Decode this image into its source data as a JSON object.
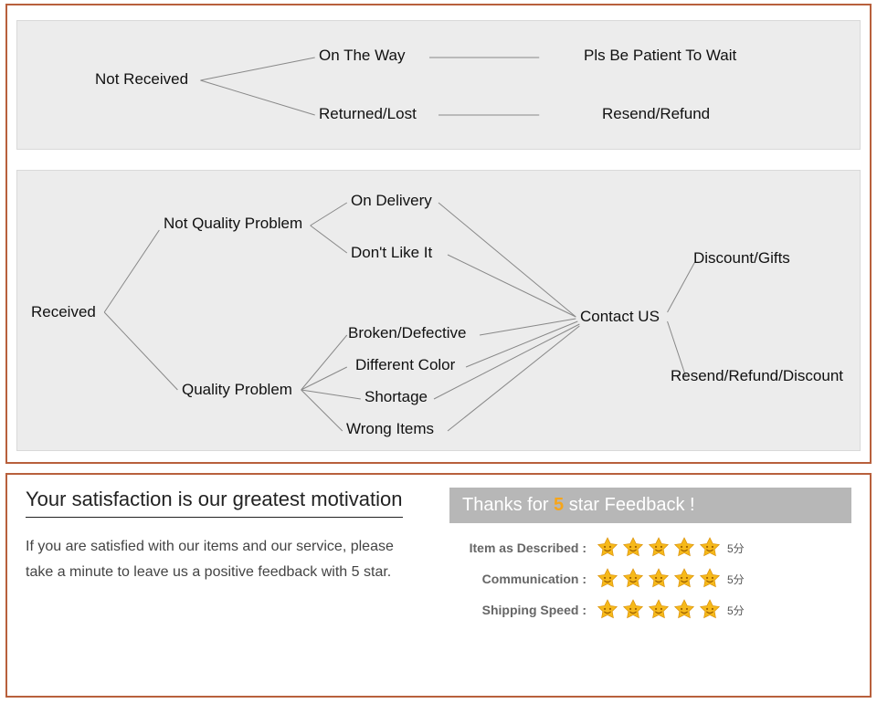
{
  "flow": {
    "not_received": "Not Received",
    "on_the_way": "On The Way",
    "pls_patient": "Pls Be Patient To Wait",
    "returned_lost": "Returned/Lost",
    "resend_refund": "Resend/Refund",
    "received": "Received",
    "not_quality": "Not Quality Problem",
    "quality": "Quality Problem",
    "on_delivery": "On Delivery",
    "dont_like": "Don't Like It",
    "broken": "Broken/Defective",
    "diff_color": "Different Color",
    "shortage": "Shortage",
    "wrong_items": "Wrong Items",
    "contact_us": "Contact US",
    "discount_gifts": "Discount/Gifts",
    "rrr": "Resend/Refund/Discount"
  },
  "feedback": {
    "title": "Your satisfaction is our greatest motivation",
    "body": "If you are satisfied with our items and our service, please take a minute to leave us a positive feedback with 5 star.",
    "banner_pre": "Thanks for ",
    "banner_num": "5",
    "banner_post": " star Feedback !",
    "rows": [
      {
        "label": "Item as Described :",
        "score": "5分"
      },
      {
        "label": "Communication :",
        "score": "5分"
      },
      {
        "label": "Shipping Speed :",
        "score": "5分"
      }
    ]
  }
}
